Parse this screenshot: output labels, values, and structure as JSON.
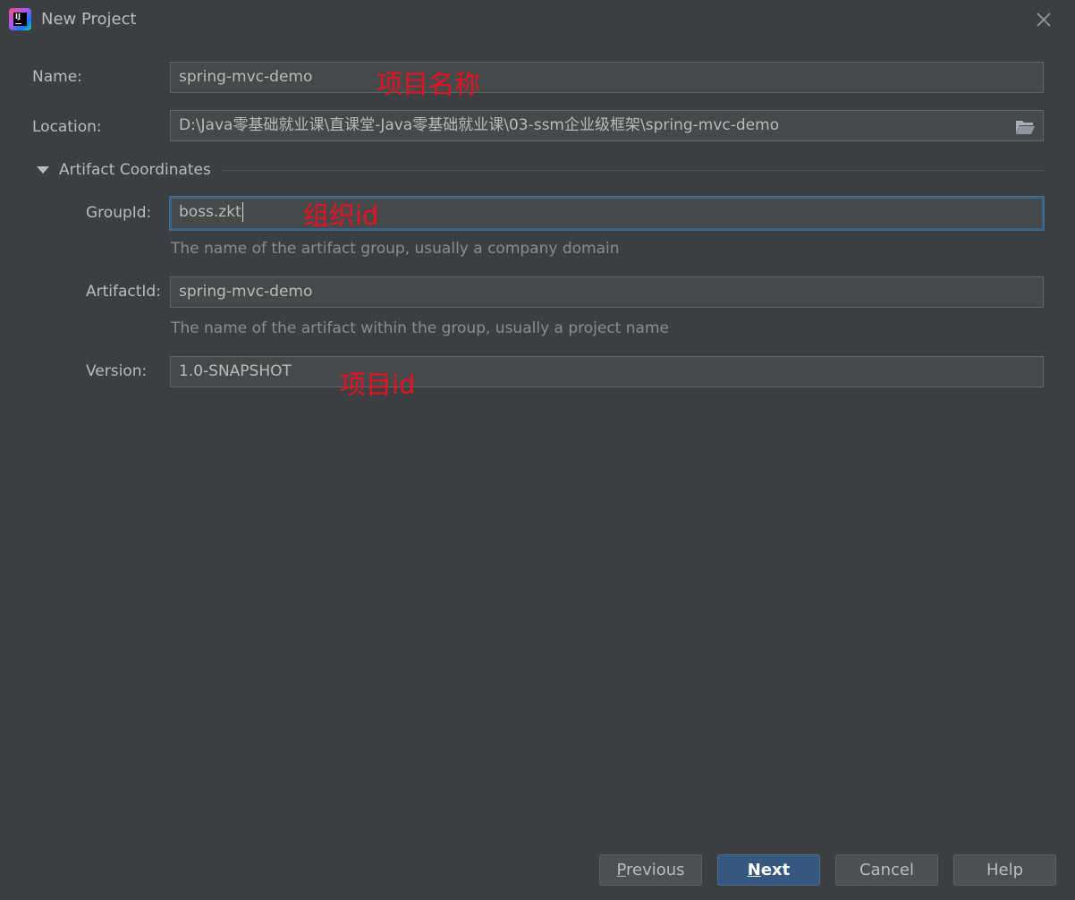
{
  "window": {
    "title": "New Project",
    "app_icon_text": "IJ"
  },
  "form": {
    "name": {
      "label": "Name:",
      "value": "spring-mvc-demo"
    },
    "location": {
      "label": "Location:",
      "value": "D:\\Java零基础就业课\\直课堂-Java零基础就业课\\03-ssm企业级框架\\spring-mvc-demo"
    },
    "artifact_section": {
      "label": "Artifact Coordinates",
      "expanded": true
    },
    "group_id": {
      "label": "GroupId:",
      "value": "boss.zkt",
      "hint": "The name of the artifact group, usually a company domain"
    },
    "artifact_id": {
      "label": "ArtifactId:",
      "value": "spring-mvc-demo",
      "hint": "The name of the artifact within the group, usually a project name"
    },
    "version": {
      "label": "Version:",
      "value": "1.0-SNAPSHOT"
    }
  },
  "annotations": {
    "project_name": "项目名称",
    "group_id": "组织id",
    "project_id": "项目id"
  },
  "buttons": {
    "previous": {
      "first": "P",
      "rest": "revious"
    },
    "next": {
      "first": "N",
      "rest": "ext"
    },
    "cancel": "Cancel",
    "help": "Help"
  },
  "colors": {
    "background": "#3c3f41",
    "field_background": "#45494a",
    "field_border": "#646464",
    "focus_border": "#3d6185",
    "primary_button": "#365880",
    "annotation_red": "#e81123",
    "text": "#bbbbbb",
    "hint_text": "#8c8c8c"
  },
  "icons": {
    "app": "intellij-idea-icon",
    "close": "close-icon",
    "folder": "folder-open-icon",
    "section_toggle": "triangle-down-icon"
  }
}
